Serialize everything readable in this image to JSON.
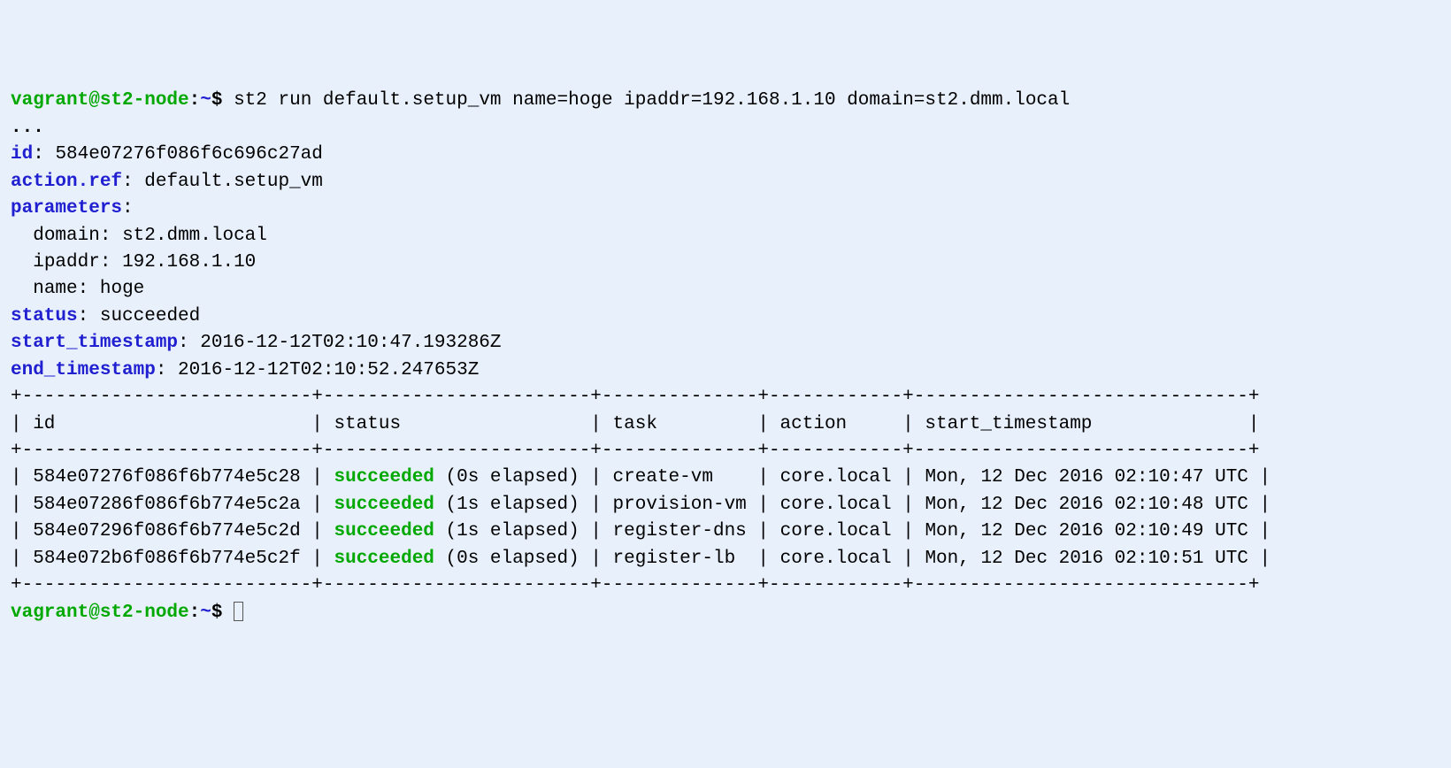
{
  "prompt": {
    "user_host": "vagrant@st2-node",
    "sep": ":",
    "path": "~",
    "dollar": "$"
  },
  "command": "st2 run default.setup_vm name=hoge ipaddr=192.168.1.10 domain=st2.dmm.local",
  "ellipsis": "...",
  "labels": {
    "id": "id",
    "action_ref": "action.ref",
    "parameters": "parameters",
    "status": "status",
    "start_timestamp": "start_timestamp",
    "end_timestamp": "end_timestamp",
    "param_domain": "domain",
    "param_ipaddr": "ipaddr",
    "param_name": "name"
  },
  "values": {
    "id": "584e07276f086f6c696c27ad",
    "action_ref": "default.setup_vm",
    "param_domain": "st2.dmm.local",
    "param_ipaddr": "192.168.1.10",
    "param_name": "hoge",
    "status": "succeeded",
    "start_timestamp": "2016-12-12T02:10:47.193286Z",
    "end_timestamp": "2016-12-12T02:10:52.247653Z"
  },
  "table": {
    "sep_top": "+--------------------------+------------------------+--------------+------------+------------------------------+",
    "header_row": "| id                       | status                 | task         | action     | start_timestamp              |",
    "sep_mid": "+--------------------------+------------------------+--------------+------------+------------------------------+",
    "sep_bot": "+--------------------------+------------------------+--------------+------------+------------------------------+",
    "headers": {
      "id": "id",
      "status": "status",
      "task": "task",
      "action": "action",
      "start_timestamp": "start_timestamp"
    },
    "rows": [
      {
        "id": "584e07276f086f6b774e5c28",
        "status_word": "succeeded",
        "status_rest": " (0s elapsed)",
        "task": "create-vm   ",
        "action": "core.local",
        "start_timestamp": "Mon, 12 Dec 2016 02:10:47 UTC"
      },
      {
        "id": "584e07286f086f6b774e5c2a",
        "status_word": "succeeded",
        "status_rest": " (1s elapsed)",
        "task": "provision-vm",
        "action": "core.local",
        "start_timestamp": "Mon, 12 Dec 2016 02:10:48 UTC"
      },
      {
        "id": "584e07296f086f6b774e5c2d",
        "status_word": "succeeded",
        "status_rest": " (1s elapsed)",
        "task": "register-dns",
        "action": "core.local",
        "start_timestamp": "Mon, 12 Dec 2016 02:10:49 UTC"
      },
      {
        "id": "584e072b6f086f6b774e5c2f",
        "status_word": "succeeded",
        "status_rest": " (0s elapsed)",
        "task": "register-lb ",
        "action": "core.local",
        "start_timestamp": "Mon, 12 Dec 2016 02:10:51 UTC"
      }
    ]
  }
}
